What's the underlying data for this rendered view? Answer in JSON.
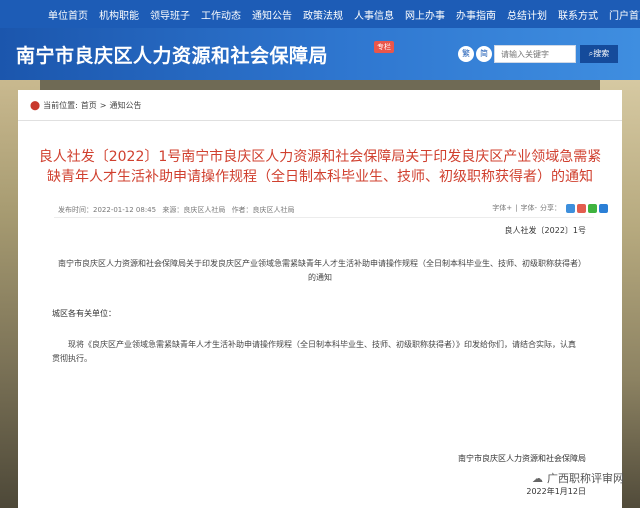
{
  "nav": {
    "items": [
      "单位首页",
      "机构职能",
      "领导班子",
      "工作动态",
      "通知公告",
      "政策法规",
      "人事信息",
      "网上办事",
      "办事指南",
      "总结计划",
      "联系方式",
      "门户首页"
    ]
  },
  "header": {
    "title": "南宁市良庆区人力资源和社会保障局",
    "badge": "专栏",
    "lang_traditional": "繁",
    "lang_simplified": "简",
    "search_placeholder": "请输入关键字",
    "search_button": "搜索"
  },
  "breadcrumb": {
    "label": "当前位置:",
    "home": "首页",
    "separator": ">",
    "current": "通知公告"
  },
  "article": {
    "title": "良人社发〔2022〕1号南宁市良庆区人力资源和社会保障局关于印发良庆区产业领域急需紧缺青年人才生活补助申请操作规程（全日制本科毕业生、技师、初级职称获得者）的通知",
    "publish_time": "发布时间：2022-01-12 08:45",
    "source": "来源：良庆区人社局",
    "author": "作者：良庆区人社局",
    "font_large": "字体+",
    "font_sep": "|",
    "font_small": "字体-",
    "share_label": "分享：",
    "doc_number": "良人社发〔2022〕1号",
    "doc_heading": "南宁市良庆区人力资源和社会保障局关于印发良庆区产业领域急需紧缺青年人才生活补助申请操作规程（全日制本科毕业生、技师、初级职称获得者）的通知",
    "salutation": "城区各有关单位：",
    "body": "现将《良庆区产业领域急需紧缺青年人才生活补助申请操作规程（全日制本科毕业生、技师、初级职称获得者）》印发给你们，请结合实际，认真贯彻执行。",
    "signature": "南宁市良庆区人力资源和社会保障局",
    "date": "2022年1月12日"
  },
  "watermark": {
    "text": "广西职称评审网"
  },
  "colors": {
    "nav_bg": "#1d5cb6",
    "header_bg": "#2f77d0",
    "title_red": "#d0402f",
    "search_button_bg": "#154b9b"
  },
  "icons": [
    "location-pin-icon",
    "share-qzone-icon",
    "share-weibo-icon",
    "share-wechat-icon",
    "share-more-icon",
    "wechat-icon"
  ]
}
